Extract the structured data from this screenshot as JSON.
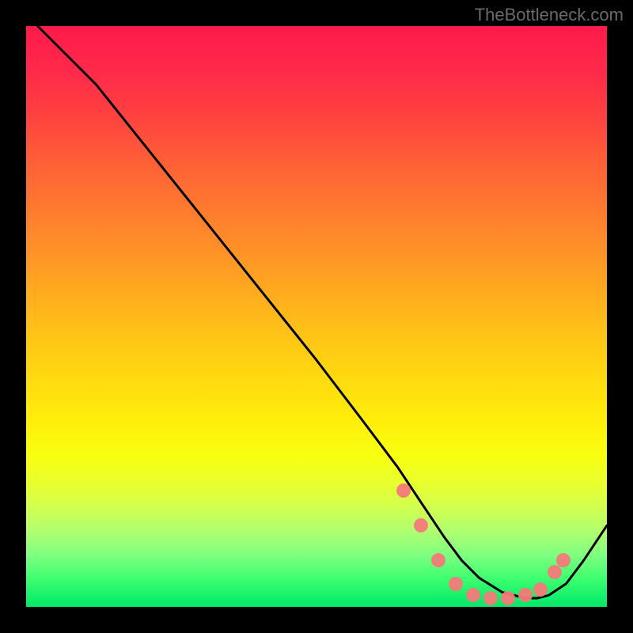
{
  "watermark": "TheBottleneck.com",
  "chart_data": {
    "type": "line",
    "title": "",
    "xlabel": "",
    "ylabel": "",
    "xlim": [
      0,
      100
    ],
    "ylim": [
      0,
      100
    ],
    "series": [
      {
        "name": "curve",
        "x": [
          0,
          2,
          5,
          8,
          12,
          20,
          30,
          40,
          50,
          58,
          64,
          68,
          72,
          75,
          78,
          82,
          86,
          88,
          90,
          93,
          96,
          100
        ],
        "values": [
          104,
          100,
          97,
          94,
          90,
          80,
          67.5,
          55,
          42.5,
          32,
          24,
          18,
          12,
          8,
          5,
          2.5,
          1.5,
          1.5,
          2,
          4,
          8,
          14
        ]
      }
    ],
    "markers": [
      {
        "x": 65,
        "y": 20
      },
      {
        "x": 68,
        "y": 14
      },
      {
        "x": 71,
        "y": 8
      },
      {
        "x": 74,
        "y": 4
      },
      {
        "x": 77,
        "y": 2
      },
      {
        "x": 80,
        "y": 1.5
      },
      {
        "x": 83,
        "y": 1.5
      },
      {
        "x": 86,
        "y": 2
      },
      {
        "x": 88.5,
        "y": 3
      },
      {
        "x": 91,
        "y": 6
      },
      {
        "x": 92.5,
        "y": 8
      }
    ],
    "gradient_stops": [
      {
        "pos": 0,
        "color": "#ff1a4a"
      },
      {
        "pos": 50,
        "color": "#ffc018"
      },
      {
        "pos": 75,
        "color": "#f8ff10"
      },
      {
        "pos": 100,
        "color": "#00e868"
      }
    ]
  }
}
